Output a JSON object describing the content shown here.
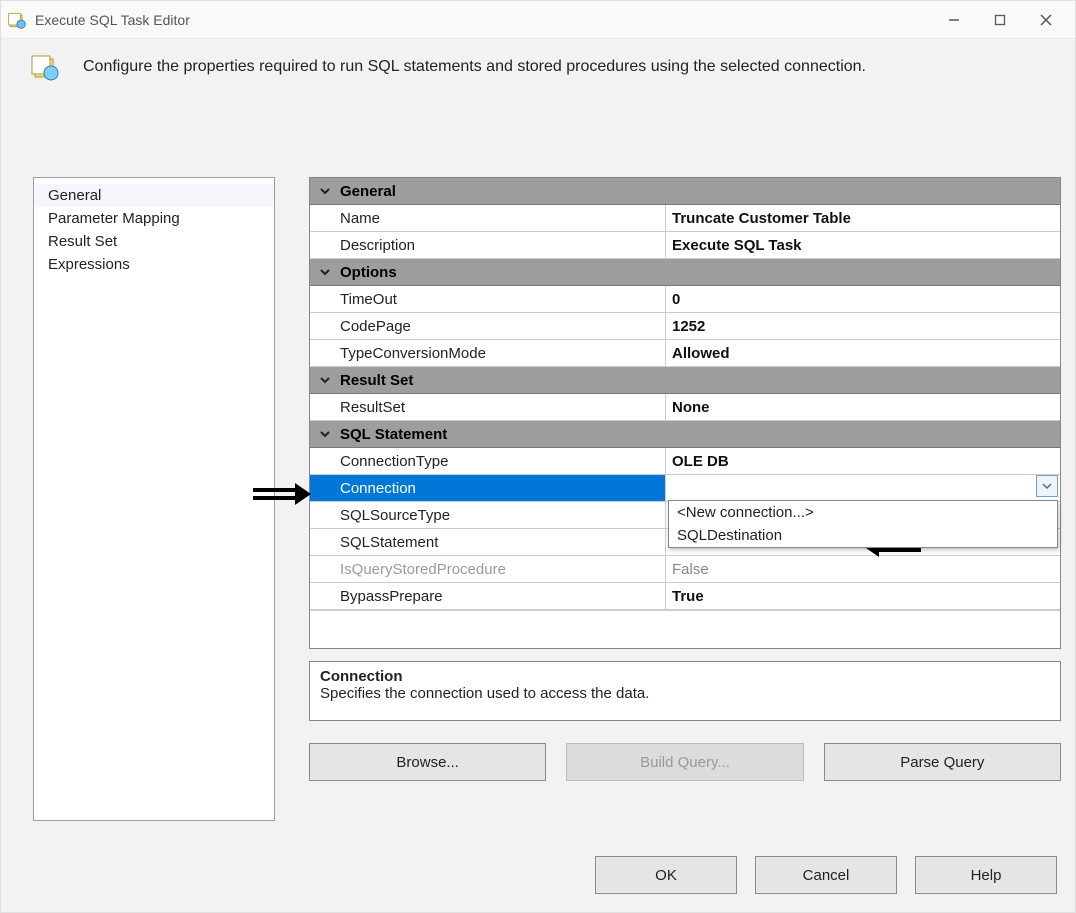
{
  "window": {
    "title": "Execute SQL Task Editor"
  },
  "description": "Configure the properties required to run SQL statements and stored procedures using the selected connection.",
  "nav": {
    "items": [
      "General",
      "Parameter Mapping",
      "Result Set",
      "Expressions"
    ],
    "selected": 0
  },
  "categories": {
    "general_label": "General",
    "options_label": "Options",
    "resultset_label": "Result Set",
    "sqlstmt_label": "SQL Statement"
  },
  "props": {
    "name_label": "Name",
    "name_value": "Truncate Customer Table",
    "description_label": "Description",
    "description_value": "Execute SQL Task",
    "timeout_label": "TimeOut",
    "timeout_value": "0",
    "codepage_label": "CodePage",
    "codepage_value": "1252",
    "typeconv_label": "TypeConversionMode",
    "typeconv_value": "Allowed",
    "resultset_label": "ResultSet",
    "resultset_value": "None",
    "conntype_label": "ConnectionType",
    "conntype_value": "OLE DB",
    "connection_label": "Connection",
    "connection_value": "",
    "sqlsrctype_label": "SQLSourceType",
    "sqlsrctype_value": "",
    "sqlstmt_label": "SQLStatement",
    "sqlstmt_value": "",
    "isquerysp_label": "IsQueryStoredProcedure",
    "isquerysp_value": "False",
    "bypass_label": "BypassPrepare",
    "bypass_value": "True"
  },
  "dropdown": {
    "items": [
      "<New connection...>",
      "SQLDestination"
    ]
  },
  "help": {
    "title": "Connection",
    "text": "Specifies the connection used to access the data."
  },
  "actions": {
    "browse": "Browse...",
    "build": "Build Query...",
    "parse": "Parse Query"
  },
  "dialog": {
    "ok": "OK",
    "cancel": "Cancel",
    "help": "Help"
  }
}
